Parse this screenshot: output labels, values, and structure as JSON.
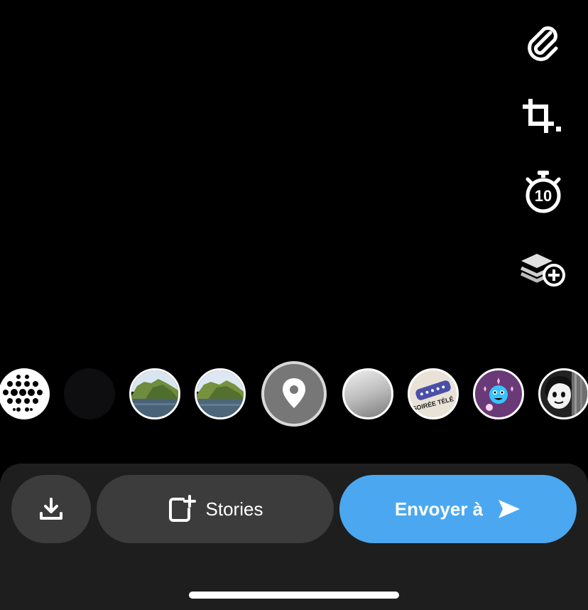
{
  "toolbar": {
    "tools": [
      {
        "icon": "paperclip-icon"
      },
      {
        "icon": "crop-icon"
      },
      {
        "icon": "timer-icon",
        "value": "10"
      },
      {
        "icon": "layers-add-icon"
      }
    ]
  },
  "filters": {
    "items": [
      {
        "name": "dot-pattern-lens"
      },
      {
        "name": "dark-lens"
      },
      {
        "name": "landscape-lens"
      },
      {
        "name": "landscape-lens"
      },
      {
        "name": "location-lens",
        "selected": true,
        "icon": "map-pin-icon"
      },
      {
        "name": "gradient-lens"
      },
      {
        "name": "soiree-tele-lens",
        "label": "SOIRÉE TÉLÉ"
      },
      {
        "name": "creature-lens"
      },
      {
        "name": "face-lens"
      }
    ]
  },
  "actions": {
    "save_icon": "download-icon",
    "stories_label": "Stories",
    "stories_icon": "add-story-icon",
    "send_label": "Envoyer à",
    "send_icon": "send-arrow-icon",
    "send_color": "#4ba8f0"
  }
}
